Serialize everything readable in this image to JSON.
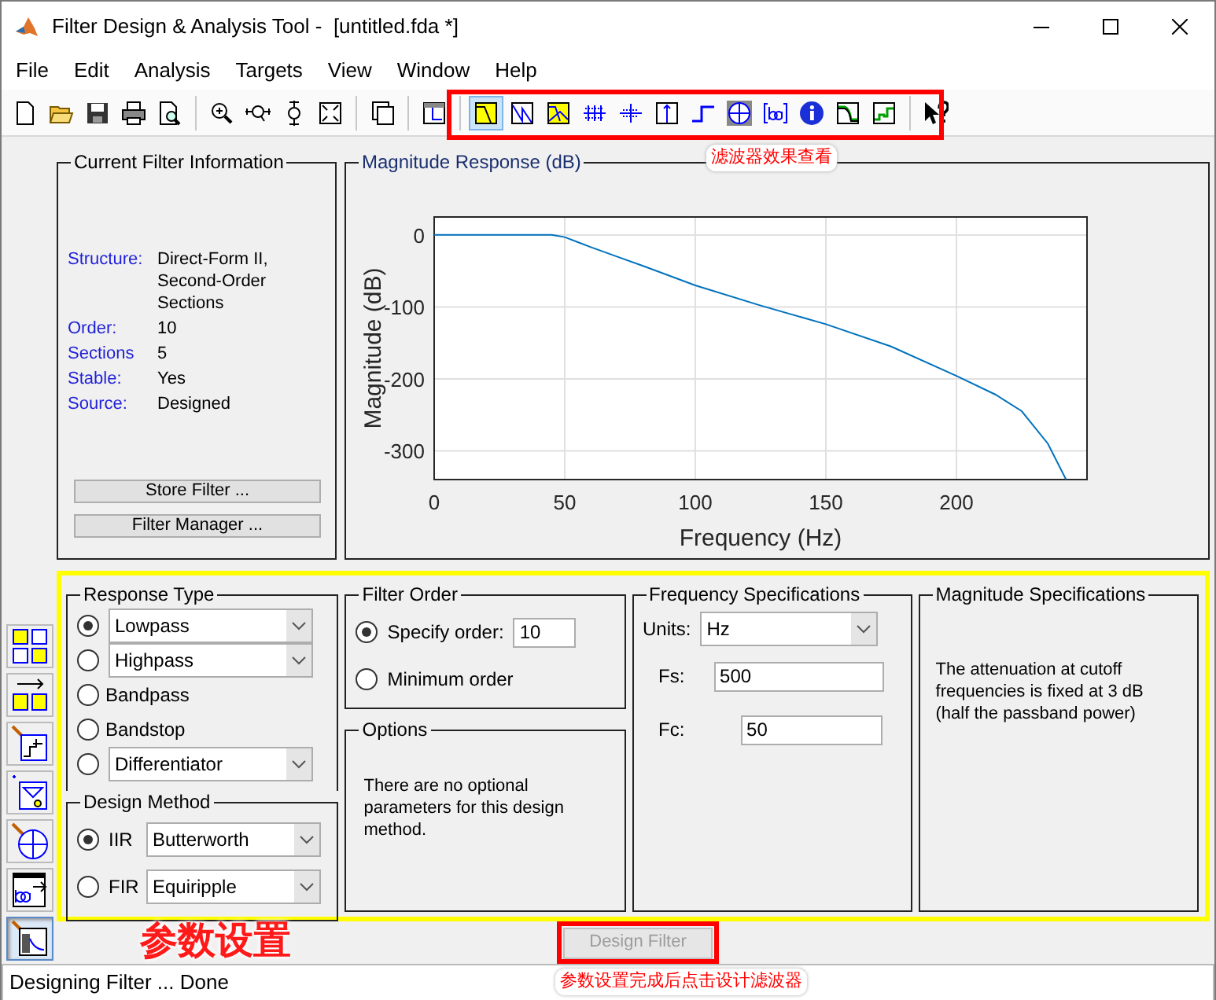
{
  "window": {
    "title": "Filter Design & Analysis Tool -  [untitled.fda *]"
  },
  "menu": [
    "File",
    "Edit",
    "Analysis",
    "Targets",
    "View",
    "Window",
    "Help"
  ],
  "analysis_buttons": [
    {
      "selected": true
    },
    {
      "selected": false
    },
    {
      "selected": false
    },
    {
      "selected": false
    },
    {
      "selected": false
    },
    {
      "selected": false
    },
    {
      "selected": false
    },
    {
      "selected": false
    },
    {
      "selected": false
    },
    {
      "selected": false
    },
    {
      "selected": false
    },
    {
      "selected": false
    }
  ],
  "current_filter_information": {
    "title": "Current Filter Information",
    "fields": [
      {
        "label": "Structure:",
        "value": "Direct-Form II, Second-Order Sections"
      },
      {
        "label": "Order:",
        "value": "10"
      },
      {
        "label": "Sections",
        "value": "5"
      },
      {
        "label": "Stable:",
        "value": "Yes"
      },
      {
        "label": "Source:",
        "value": "Designed"
      }
    ],
    "buttons": [
      "Store Filter ...",
      "Filter Manager ..."
    ]
  },
  "magnitude_response": {
    "title": "Magnitude Response (dB)",
    "chart_data": {
      "type": "line",
      "xlabel": "Frequency (Hz)",
      "ylabel": "Magnitude (dB)",
      "x": [
        0,
        40,
        45,
        50,
        55,
        60,
        70,
        80,
        100,
        125,
        150,
        175,
        200,
        215,
        225,
        235,
        242
      ],
      "grid": true,
      "series": [
        {
          "color": "#0072bd",
          "values": [
            0,
            0,
            0,
            -3,
            -10,
            -17,
            -30,
            -43,
            -70,
            -98,
            -124,
            -155,
            -196,
            -222,
            -245,
            -290,
            -340
          ]
        }
      ],
      "xlim": [
        0,
        250
      ],
      "ylim": [
        -340,
        25
      ],
      "xticks": [
        0,
        50,
        100,
        150,
        200
      ],
      "yticks": [
        0,
        -100,
        -200,
        -300
      ]
    }
  },
  "sidebar_buttons": [
    {
      "selected": false
    },
    {
      "selected": false
    },
    {
      "selected": false
    },
    {
      "selected": false
    },
    {
      "selected": false
    },
    {
      "selected": false
    },
    {
      "selected": true
    }
  ],
  "response_type": {
    "title": "Response Type",
    "options": [
      {
        "kind": "dropdown",
        "text": "Lowpass",
        "selected": true
      },
      {
        "kind": "dropdown",
        "text": "Highpass",
        "selected": false
      },
      {
        "kind": "label",
        "text": "Bandpass",
        "selected": false
      },
      {
        "kind": "label",
        "text": "Bandstop",
        "selected": false
      },
      {
        "kind": "dropdown",
        "text": "Differentiator",
        "selected": false
      }
    ]
  },
  "design_method": {
    "title": "Design Method",
    "options": [
      {
        "label": "IIR",
        "value": "Butterworth",
        "selected": true
      },
      {
        "label": "FIR",
        "value": "Equiripple",
        "selected": false
      }
    ]
  },
  "filter_order": {
    "title": "Filter Order",
    "options": [
      {
        "label": "Specify order:",
        "value": "10",
        "selected": true
      },
      {
        "label": "Minimum order",
        "selected": false
      }
    ]
  },
  "options": {
    "title": "Options",
    "text": "There are no optional parameters for this design method."
  },
  "frequency_specifications": {
    "title": "Frequency Specifications",
    "units_label": "Units:",
    "units": "Hz",
    "fields": [
      {
        "label": "Fs:",
        "value": "500"
      },
      {
        "label": "Fc:",
        "value": "50"
      }
    ]
  },
  "magnitude_specifications": {
    "title": "Magnitude Specifications",
    "text": "The attenuation at cutoff frequencies is fixed at 3 dB (half the passband power)"
  },
  "design_button": {
    "label": "Design Filter",
    "disabled": true
  },
  "status_bar": "Designing Filter ... Done",
  "annotations": [
    {
      "text": "滤波器效果查看"
    },
    {
      "text": "参数设置"
    },
    {
      "text": "参数设置完成后点击设计滤波器"
    }
  ]
}
